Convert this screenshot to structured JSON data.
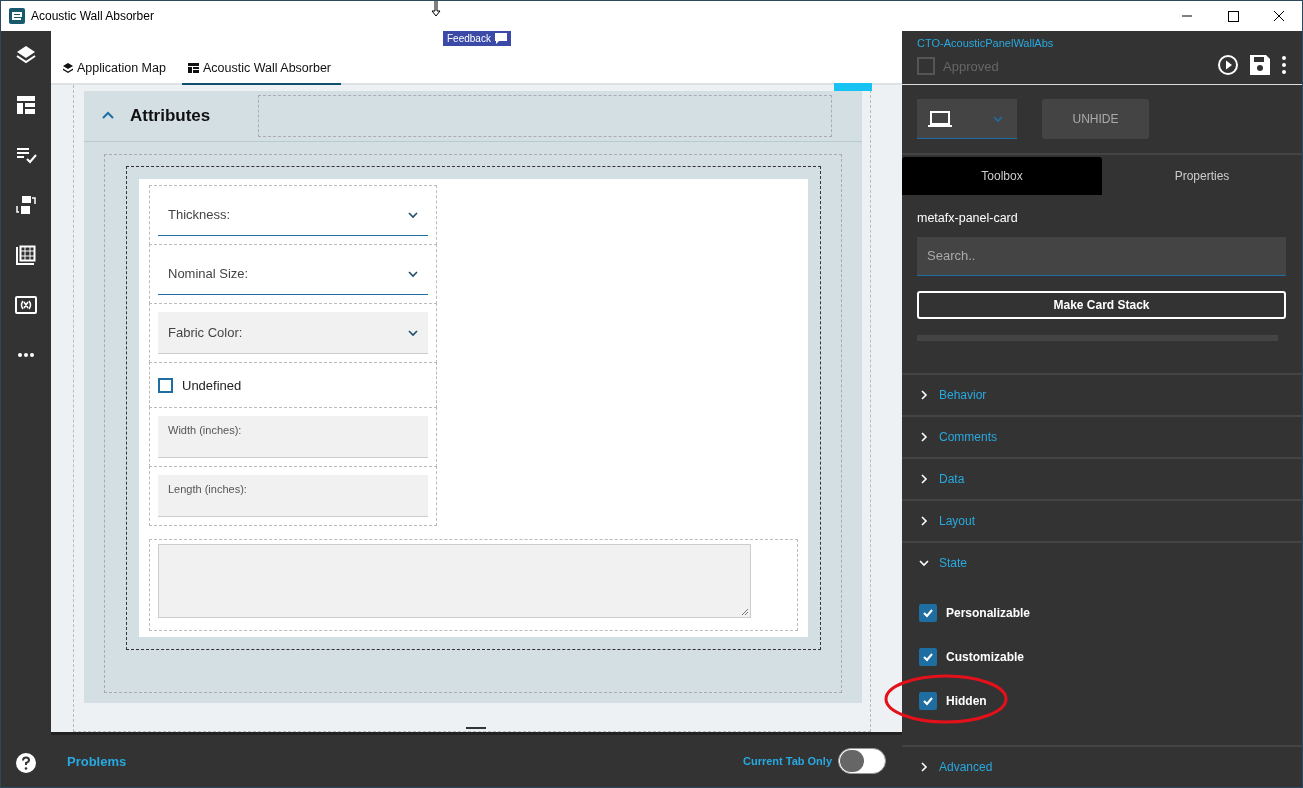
{
  "window": {
    "title": "Acoustic Wall Absorber"
  },
  "feedback": {
    "label": "Feedback"
  },
  "tabs": [
    {
      "label": "Application Map",
      "kind": "map",
      "selected": false
    },
    {
      "label": "Acoustic Wall Absorber",
      "kind": "page",
      "selected": true
    }
  ],
  "panel": {
    "title": "Attributes",
    "expanded": true
  },
  "fields": [
    {
      "kind": "dropdown",
      "label": "Thickness:",
      "disabled": false
    },
    {
      "kind": "dropdown",
      "label": "Nominal Size:",
      "disabled": false
    },
    {
      "kind": "dropdown",
      "label": "Fabric Color:",
      "disabled": true
    },
    {
      "kind": "checkbox",
      "label": "Undefined",
      "checked": false
    },
    {
      "kind": "text",
      "label": "Width (inches):"
    },
    {
      "kind": "text",
      "label": "Length (inches):"
    }
  ],
  "problems": {
    "label": "Problems"
  },
  "current_tab_only": {
    "label": "Current Tab Only",
    "on": false
  },
  "project": {
    "name": "CTO-AcousticPanelWallAbs",
    "approved": {
      "label": "Approved",
      "checked": false
    }
  },
  "unhide": {
    "label": "UNHIDE"
  },
  "panel_tabs": [
    {
      "label": "Toolbox",
      "selected": true
    },
    {
      "label": "Properties",
      "selected": false
    }
  ],
  "component": "metafx-panel-card",
  "search": {
    "placeholder": "Search.."
  },
  "make_card_stack": {
    "label": "Make Card Stack"
  },
  "sections": [
    {
      "label": "Behavior",
      "expanded": false
    },
    {
      "label": "Comments",
      "expanded": false
    },
    {
      "label": "Data",
      "expanded": false
    },
    {
      "label": "Layout",
      "expanded": false
    },
    {
      "label": "State",
      "expanded": true,
      "options": [
        {
          "label": "Personalizable",
          "checked": true,
          "circled": false
        },
        {
          "label": "Customizable",
          "checked": true,
          "circled": false
        },
        {
          "label": "Hidden",
          "checked": true,
          "circled": true
        }
      ]
    },
    {
      "label": "Advanced",
      "expanded": false
    }
  ]
}
